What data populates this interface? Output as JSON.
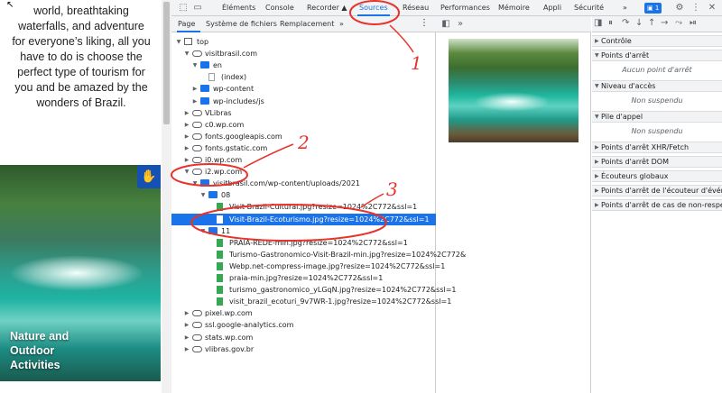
{
  "page": {
    "text_lines": [
      "world, breathtaking",
      "waterfalls, and adventure",
      "for everyone’s liking, all you",
      "have to do is choose the",
      "perfect type of tourism for",
      "you and be amazed by the",
      "wonders of Brazil."
    ],
    "hero_label_lines": [
      "Nature and",
      "Outdoor",
      "Activities"
    ]
  },
  "devtools": {
    "tabs": [
      "Éléments",
      "Console",
      "Recorder ▲",
      "Sources",
      "Réseau",
      "Performances",
      "Mémoire",
      "Appli",
      "Sécurité",
      "»"
    ],
    "active_tab": "Sources",
    "issues_count": "1",
    "navigator_tabs": [
      "Page",
      "Système de fichiers",
      "Remplacement",
      "»"
    ],
    "tree": [
      {
        "label": "top",
        "depth": 0,
        "icon": "top",
        "arrow": "▼"
      },
      {
        "label": "visitbrasil.com",
        "depth": 1,
        "icon": "cloud",
        "arrow": "▼"
      },
      {
        "label": "en",
        "depth": 2,
        "icon": "folder",
        "arrow": "▼"
      },
      {
        "label": "(index)",
        "depth": 3,
        "icon": "file",
        "arrow": ""
      },
      {
        "label": "wp-content",
        "depth": 2,
        "icon": "folder",
        "arrow": "▶"
      },
      {
        "label": "wp-includes/js",
        "depth": 2,
        "icon": "folder",
        "arrow": "▶"
      },
      {
        "label": "VLibras",
        "depth": 1,
        "icon": "cloud",
        "arrow": "▶"
      },
      {
        "label": "c0.wp.com",
        "depth": 1,
        "icon": "cloud",
        "arrow": "▶"
      },
      {
        "label": "fonts.googleapis.com",
        "depth": 1,
        "icon": "cloud",
        "arrow": "▶"
      },
      {
        "label": "fonts.gstatic.com",
        "depth": 1,
        "icon": "cloud",
        "arrow": "▶"
      },
      {
        "label": "i0.wp.com",
        "depth": 1,
        "icon": "cloud",
        "arrow": "▶"
      },
      {
        "label": "i2.wp.com",
        "depth": 1,
        "icon": "cloud",
        "arrow": "▼"
      },
      {
        "label": "visitbrasil.com/wp-content/uploads/2021",
        "depth": 2,
        "icon": "folder",
        "arrow": "▼"
      },
      {
        "label": "08",
        "depth": 3,
        "icon": "folder",
        "arrow": "▼"
      },
      {
        "label": "Visit-Brazil-Cultural.jpg?resize=1024%2C772&ssl=1",
        "depth": 4,
        "icon": "img",
        "arrow": ""
      },
      {
        "label": "Visit-Brazil-Ecoturismo.jpg?resize=1024%2C772&ssl=1",
        "depth": 4,
        "icon": "img",
        "arrow": "",
        "selected": true
      },
      {
        "label": "11",
        "depth": 3,
        "icon": "folder",
        "arrow": "▼"
      },
      {
        "label": "PRAIA-REDE-min.jpg?resize=1024%2C772&ssl=1",
        "depth": 4,
        "icon": "img",
        "arrow": ""
      },
      {
        "label": "Turismo-Gastronomico-Visit-Brazil-min.jpg?resize=1024%2C772&",
        "depth": 4,
        "icon": "img",
        "arrow": ""
      },
      {
        "label": "Webp.net-compress-image.jpg?resize=1024%2C772&ssl=1",
        "depth": 4,
        "icon": "img",
        "arrow": ""
      },
      {
        "label": "praia-min.jpg?resize=1024%2C772&ssl=1",
        "depth": 4,
        "icon": "img",
        "arrow": ""
      },
      {
        "label": "turismo_gastronomico_yLGqN.jpg?resize=1024%2C772&ssl=1",
        "depth": 4,
        "icon": "img",
        "arrow": ""
      },
      {
        "label": "visit_brazil_ecoturi_9v7WR-1.jpg?resize=1024%2C772&ssl=1",
        "depth": 4,
        "icon": "img",
        "arrow": ""
      },
      {
        "label": "pixel.wp.com",
        "depth": 1,
        "icon": "cloud",
        "arrow": "▶"
      },
      {
        "label": "ssl.google-analytics.com",
        "depth": 1,
        "icon": "cloud",
        "arrow": "▶"
      },
      {
        "label": "stats.wp.com",
        "depth": 1,
        "icon": "cloud",
        "arrow": "▶"
      },
      {
        "label": "vlibras.gov.br",
        "depth": 1,
        "icon": "cloud",
        "arrow": "▶"
      }
    ],
    "debugger_sections": [
      {
        "title": "Contrôle",
        "arrow": "▶",
        "empty": ""
      },
      {
        "title": "Points d'arrêt",
        "arrow": "▼",
        "empty": "Aucun point d'arrêt"
      },
      {
        "title": "Niveau d'accès",
        "arrow": "▼",
        "empty": "Non suspendu"
      },
      {
        "title": "Pile d'appel",
        "arrow": "▼",
        "empty": "Non suspendu"
      },
      {
        "title": "Points d'arrêt XHR/Fetch",
        "arrow": "▶",
        "empty": ""
      },
      {
        "title": "Points d'arrêt DOM",
        "arrow": "▶",
        "empty": ""
      },
      {
        "title": "Écouteurs globaux",
        "arrow": "▶",
        "empty": ""
      },
      {
        "title": "Points d'arrêt de l'écouteur d'événem",
        "arrow": "▶",
        "empty": ""
      },
      {
        "title": "Points d'arrêt de cas de non-respect C",
        "arrow": "▶",
        "empty": ""
      }
    ]
  },
  "annotations": [
    "1",
    "2",
    "3"
  ],
  "colors": {
    "accent": "#1a73e8",
    "annotation": "#e8322b"
  }
}
